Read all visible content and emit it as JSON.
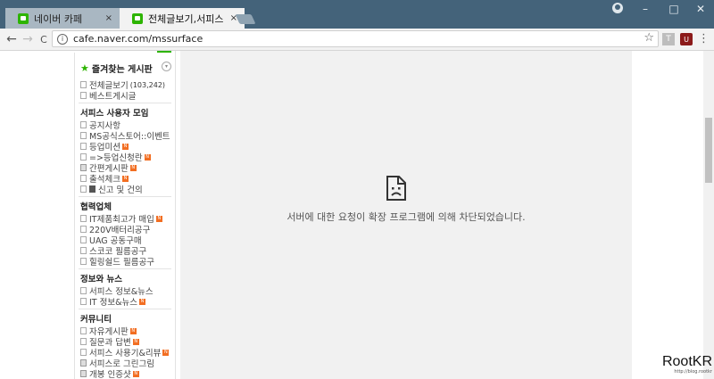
{
  "browser": {
    "tabs": [
      {
        "title": "네이버 카페",
        "close": "×"
      },
      {
        "title": "전체글보기,서피스 공식",
        "close": "×"
      }
    ],
    "url": "cafe.naver.com/mssurface",
    "info_glyph": "i",
    "star_glyph": "☆",
    "ext_tester_label": "T",
    "ext_shield_label": "U",
    "menu_glyph": "⋮",
    "back_glyph": "←",
    "forward_glyph": "→",
    "reload_glyph": "C",
    "minimize_glyph": "–",
    "maximize_glyph": "□",
    "close_glyph": "✕"
  },
  "sidebar": {
    "favorites_title": "즐겨찾는 게시판",
    "favorites_toggle": "▾",
    "top_items": [
      {
        "label": "전체글보기",
        "count": "(103,242)"
      },
      {
        "label": "베스트게시글"
      }
    ],
    "groups": [
      {
        "title": "서피스 사용자 모임",
        "items": [
          {
            "label": "공지사항"
          },
          {
            "label": "MS공식스토어::이벤트"
          },
          {
            "label": "등업미션",
            "badge": "N"
          },
          {
            "label": "=>등업신청란",
            "badge": "N"
          },
          {
            "label": "간편게시판",
            "badge": "N"
          },
          {
            "label": "출석체크",
            "badge": "N"
          },
          {
            "label": "신고 및 건의"
          }
        ]
      },
      {
        "title": "협력업체",
        "items": [
          {
            "label": "IT제품최고가 매입",
            "badge": "N"
          },
          {
            "label": "220V배터리공구"
          },
          {
            "label": "UAG 공동구매"
          },
          {
            "label": "스코코 필름공구"
          },
          {
            "label": "힐링쉴드 필름공구"
          }
        ]
      },
      {
        "title": "정보와 뉴스",
        "items": [
          {
            "label": "서피스 정보&뉴스"
          },
          {
            "label": "IT 정보&뉴스",
            "badge": "N"
          }
        ]
      },
      {
        "title": "커뮤니티",
        "items": [
          {
            "label": "자유게시판",
            "badge": "N"
          },
          {
            "label": "질문과 답변",
            "badge": "N"
          },
          {
            "label": "서피스 사용기&리뷰",
            "badge": "N"
          },
          {
            "label": "서피스로 그린그림"
          },
          {
            "label": "개봉 인증샷",
            "badge": "N"
          }
        ]
      }
    ]
  },
  "content": {
    "blocked_message": "서버에 대한 요청이 확장 프로그램에 의해 차단되었습니다.",
    "error_icon": "broken-page-icon"
  },
  "watermark": {
    "brand": "RootKR",
    "url": "http://blog.rootkr"
  },
  "colors": {
    "tabbar": "#44637a",
    "naver_green": "#2db400",
    "badge_orange": "#f26e22",
    "blocked_bg": "#f1f1f1"
  }
}
